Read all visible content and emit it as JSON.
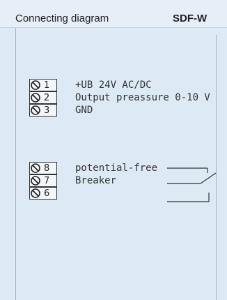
{
  "header": {
    "title": "Connecting diagram",
    "model": "SDF-W"
  },
  "group1": [
    {
      "num": "1",
      "label": "+UB 24V AC/DC"
    },
    {
      "num": "2",
      "label": "Output preassure 0-10 V"
    },
    {
      "num": "3",
      "label": "GND"
    }
  ],
  "group2": [
    {
      "num": "8",
      "label": "potential-free"
    },
    {
      "num": "7",
      "label": "Breaker"
    },
    {
      "num": "6",
      "label": ""
    }
  ],
  "colors": {
    "panel": "#dde9f4",
    "header": "#e6eef7",
    "line": "#333333"
  },
  "icons": {
    "terminal": "screw-terminal-icon",
    "switch": "breaker-switch-icon"
  }
}
